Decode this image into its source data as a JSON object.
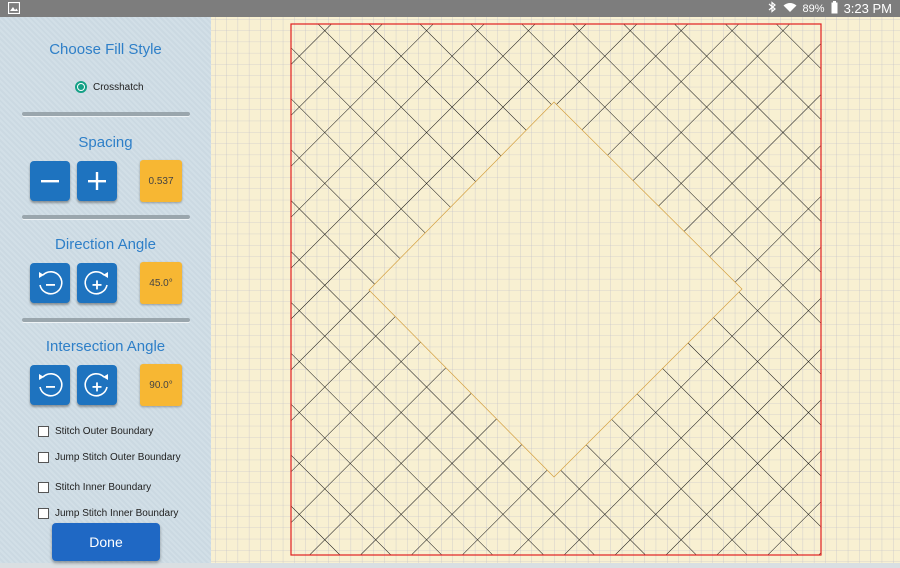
{
  "status_bar": {
    "battery": "89%",
    "time": "3:23 PM"
  },
  "panel": {
    "fill_style_title": "Choose Fill Style",
    "fill_option": "Crosshatch",
    "spacing_title": "Spacing",
    "spacing_value": "0.537",
    "direction_title": "Direction Angle",
    "direction_value": "45.0°",
    "intersection_title": "Intersection Angle",
    "intersection_value": "90.0°",
    "checks": [
      {
        "label": "Stitch Outer Boundary",
        "checked": false
      },
      {
        "label": "Jump Stitch Outer Boundary",
        "checked": false
      },
      {
        "label": "Stitch Inner Boundary",
        "checked": false
      },
      {
        "label": "Jump Stitch Inner Boundary",
        "checked": false
      }
    ],
    "done_label": "Done"
  },
  "colors": {
    "accent_blue": "#1e73bf",
    "value_orange": "#f7b733",
    "canvas_bg": "#f8f0d2",
    "grid_line": "#b9b9c8",
    "outer_boundary": "#e02020",
    "hatch": "#111111"
  }
}
